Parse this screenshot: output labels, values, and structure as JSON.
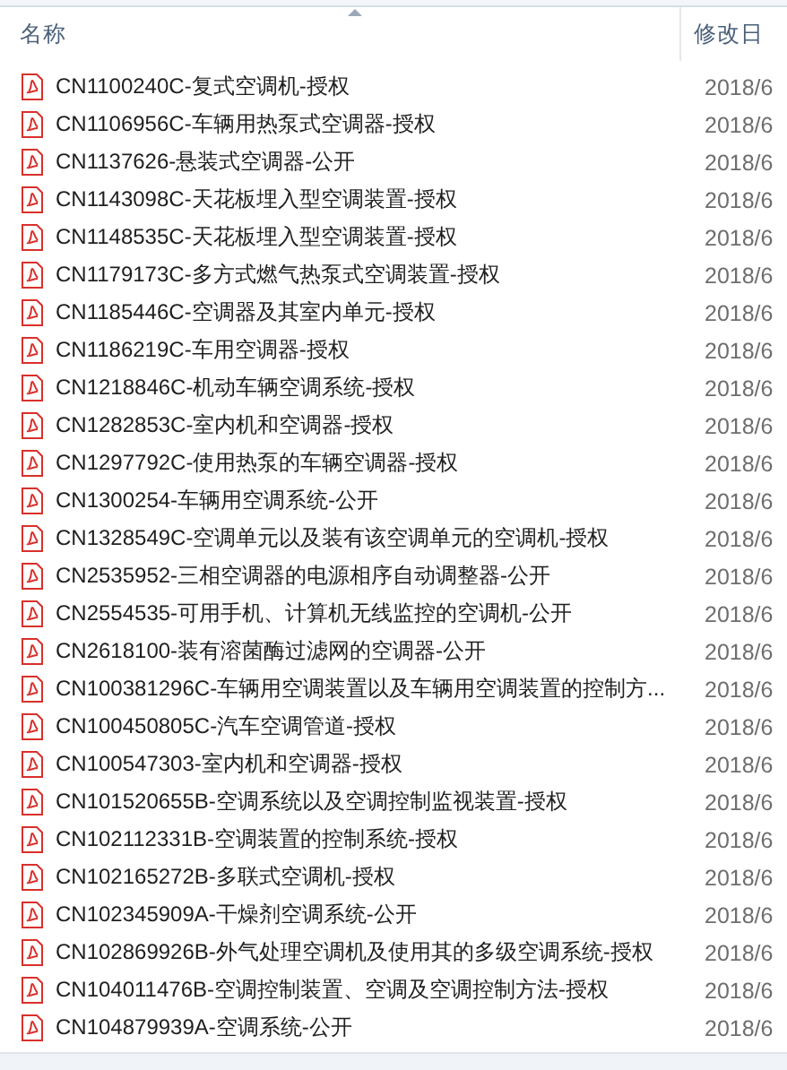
{
  "columns": [
    {
      "label": "名称",
      "sorted": true
    },
    {
      "label": "修改日",
      "sorted": false
    }
  ],
  "files": [
    {
      "name": "CN1100240C-复式空调机-授权",
      "date": "2018/6"
    },
    {
      "name": "CN1106956C-车辆用热泵式空调器-授权",
      "date": "2018/6"
    },
    {
      "name": "CN1137626-悬装式空调器-公开",
      "date": "2018/6"
    },
    {
      "name": "CN1143098C-天花板埋入型空调装置-授权",
      "date": "2018/6"
    },
    {
      "name": "CN1148535C-天花板埋入型空调装置-授权",
      "date": "2018/6"
    },
    {
      "name": "CN1179173C-多方式燃气热泵式空调装置-授权",
      "date": "2018/6"
    },
    {
      "name": "CN1185446C-空调器及其室内单元-授权",
      "date": "2018/6"
    },
    {
      "name": "CN1186219C-车用空调器-授权",
      "date": "2018/6"
    },
    {
      "name": "CN1218846C-机动车辆空调系统-授权",
      "date": "2018/6"
    },
    {
      "name": "CN1282853C-室内机和空调器-授权",
      "date": "2018/6"
    },
    {
      "name": "CN1297792C-使用热泵的车辆空调器-授权",
      "date": "2018/6"
    },
    {
      "name": "CN1300254-车辆用空调系统-公开",
      "date": "2018/6"
    },
    {
      "name": "CN1328549C-空调单元以及装有该空调单元的空调机-授权",
      "date": "2018/6"
    },
    {
      "name": "CN2535952-三相空调器的电源相序自动调整器-公开",
      "date": "2018/6"
    },
    {
      "name": "CN2554535-可用手机、计算机无线监控的空调机-公开",
      "date": "2018/6"
    },
    {
      "name": "CN2618100-装有溶菌酶过滤网的空调器-公开",
      "date": "2018/6"
    },
    {
      "name": "CN100381296C-车辆用空调装置以及车辆用空调装置的控制方...",
      "date": "2018/6"
    },
    {
      "name": "CN100450805C-汽车空调管道-授权",
      "date": "2018/6"
    },
    {
      "name": "CN100547303-室内机和空调器-授权",
      "date": "2018/6"
    },
    {
      "name": "CN101520655B-空调系统以及空调控制监视装置-授权",
      "date": "2018/6"
    },
    {
      "name": "CN102112331B-空调装置的控制系统-授权",
      "date": "2018/6"
    },
    {
      "name": "CN102165272B-多联式空调机-授权",
      "date": "2018/6"
    },
    {
      "name": "CN102345909A-干燥剂空调系统-公开",
      "date": "2018/6"
    },
    {
      "name": "CN102869926B-外气处理空调机及使用其的多级空调系统-授权",
      "date": "2018/6"
    },
    {
      "name": "CN104011476B-空调控制装置、空调及空调控制方法-授权",
      "date": "2018/6"
    },
    {
      "name": "CN104879939A-空调系统-公开",
      "date": "2018/6"
    }
  ]
}
